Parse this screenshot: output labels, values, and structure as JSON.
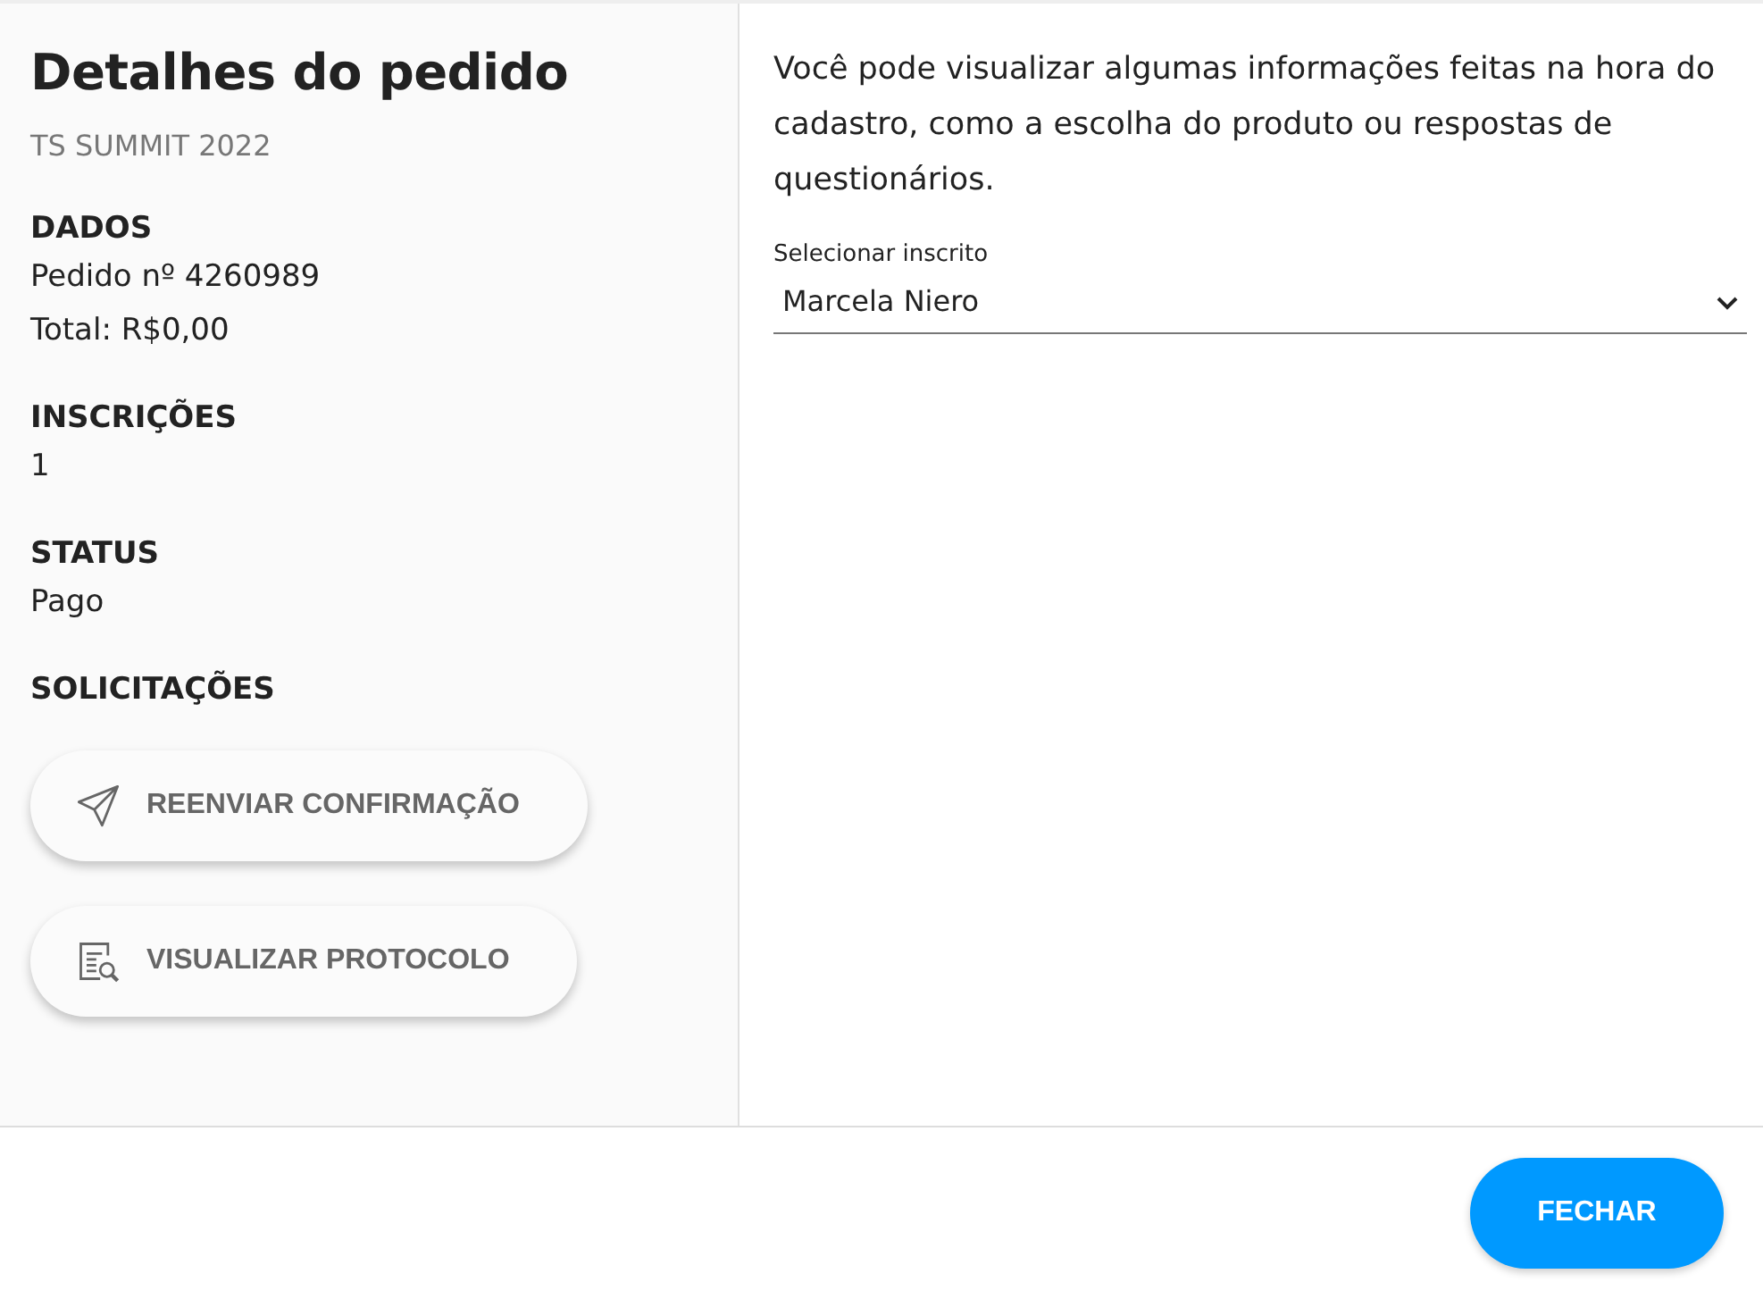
{
  "title": "Detalhes do pedido",
  "subtitle": "TS SUMMIT 2022",
  "sections": [
    {
      "heading": "DADOS",
      "lines": [
        "Pedido nº 4260989",
        "Total: R$0,00"
      ]
    },
    {
      "heading": "INSCRIÇÕES",
      "lines": [
        "1"
      ]
    },
    {
      "heading": "STATUS",
      "lines": [
        "Pago"
      ]
    },
    {
      "heading": "SOLICITAÇÕES"
    }
  ],
  "actions": [
    {
      "label": "REENVIAR CONFIRMAÇÃO",
      "kind": "send"
    },
    {
      "label": "VISUALIZAR PROTOCOLO",
      "kind": "document-search"
    }
  ],
  "description": "Você pode visualizar algumas informações feitas na hora do cadastro, como a escolha do produto ou respostas de questionários.",
  "select": {
    "label": "Selecionar inscrito",
    "value": "Marcela Niero"
  },
  "footer_button": "FECHAR"
}
